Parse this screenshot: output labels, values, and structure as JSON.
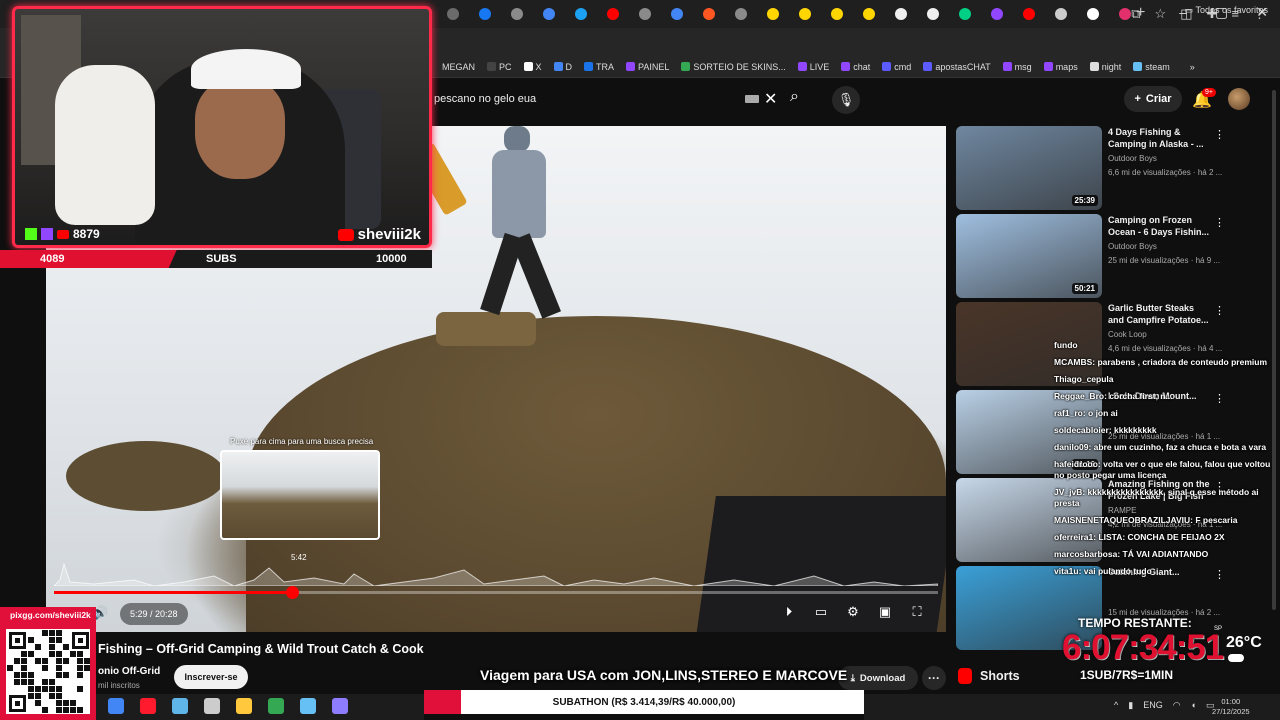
{
  "browser": {
    "tab_icons": [
      {
        "name": "tab-icon-a",
        "color": "#6b6b6b"
      },
      {
        "name": "tab-icon-facebook",
        "color": "#1877f2"
      },
      {
        "name": "tab-icon-b",
        "color": "#8a8a8a"
      },
      {
        "name": "tab-icon-google",
        "color": "#4285f4"
      },
      {
        "name": "tab-icon-c",
        "color": "#1da1f2"
      },
      {
        "name": "tab-icon-youtube",
        "color": "#ff0000"
      },
      {
        "name": "tab-icon-d",
        "color": "#8a8a8a"
      },
      {
        "name": "tab-icon-e",
        "color": "#4285f4"
      },
      {
        "name": "tab-icon-f",
        "color": "#ff5722"
      },
      {
        "name": "tab-icon-g",
        "color": "#8a8a8a"
      },
      {
        "name": "tab-icon-h",
        "color": "#ffd600"
      },
      {
        "name": "tab-icon-i",
        "color": "#ffd600"
      },
      {
        "name": "tab-icon-j",
        "color": "#ffd600"
      },
      {
        "name": "tab-icon-k",
        "color": "#ffd600"
      },
      {
        "name": "tab-icon-amazon",
        "color": "#f0f0f0"
      },
      {
        "name": "tab-icon-amazon-2",
        "color": "#f0f0f0"
      },
      {
        "name": "tab-icon-l",
        "color": "#00d084"
      },
      {
        "name": "tab-icon-twitch",
        "color": "#9146ff"
      },
      {
        "name": "tab-icon-m",
        "color": "#ff0000"
      },
      {
        "name": "tab-icon-download",
        "color": "#cccccc"
      },
      {
        "name": "tab-icon-tiktok",
        "color": "#ffffff"
      },
      {
        "name": "tab-icon-instagram",
        "color": "#e1306c"
      }
    ],
    "tab_new": "+",
    "bookmarks": [
      {
        "label": "MEGAN",
        "color": "#00000000"
      },
      {
        "label": "PC",
        "color": "#444444"
      },
      {
        "label": "X",
        "color": "#ffffff"
      },
      {
        "label": "D",
        "color": "#4285f4"
      },
      {
        "label": "TRA",
        "color": "#1a73e8"
      },
      {
        "label": "PAINEL",
        "color": "#9146ff"
      },
      {
        "label": "SORTEIO DE SKINS...",
        "color": "#34a853"
      },
      {
        "label": "LIVE",
        "color": "#9146ff"
      },
      {
        "label": "chat",
        "color": "#9146ff"
      },
      {
        "label": "cmd",
        "color": "#5b5bff"
      },
      {
        "label": "apostasCHAT",
        "color": "#5b5bff"
      },
      {
        "label": "msg",
        "color": "#9146ff"
      },
      {
        "label": "maps",
        "color": "#9146ff"
      },
      {
        "label": "night",
        "color": "#dddddd"
      },
      {
        "label": "steam",
        "color": "#66c0f4"
      }
    ],
    "bookmarks_more": "»",
    "all_bookmarks": "Todos os favoritos"
  },
  "youtube": {
    "search_value": "pescano no gelo eua",
    "create_label": "Criar",
    "notif_badge": "9+",
    "video": {
      "preview_hint": "Puxe para cima para uma busca precisa",
      "preview_time": "5:42",
      "time_display": "5:29 / 20:28",
      "progress_fraction": 0.269
    },
    "title": "Fishing – Off-Grid Camping & Wild Trout Catch & Cook",
    "channel": "onio Off-Grid",
    "channel_subs": "mil inscritos",
    "subscribe_label": "Inscrever-se",
    "download_label": "Download",
    "shorts_label": "Shorts",
    "recommendations": [
      {
        "title": "4 Days Fishing & Camping in Alaska - ...",
        "channel": "Outdoor Boys",
        "meta": "6,6 mi de visualizações · há 2 ...",
        "duration": "25:39",
        "thumb": "#6f87a0"
      },
      {
        "title": "Camping on Frozen Ocean - 6 Days Fishin...",
        "channel": "Outdoor Boys",
        "meta": "25 mi de visualizações · há 9 ...",
        "duration": "50:21",
        "thumb": "#9fbfe0"
      },
      {
        "title": "Garlic Butter Steaks and Campfire Potatoe...",
        "channel": "Cook Loop",
        "meta": "4,6 mi de visualizações · há 4 ...",
        "duration": "",
        "thumb": "#4a3528"
      },
      {
        "title": "I Solo Down Mount...",
        "channel": "",
        "meta": "25 mi de visualizações · há 1 ...",
        "duration": "31:16",
        "thumb": "#b9d0e6"
      },
      {
        "title": "Amazing Fishing on the Frozen Lake | Big Fish",
        "channel": "RAMPE",
        "meta": "4,2 mi de visualizações · há 1 ...",
        "duration": "",
        "thumb": "#c7d8ea"
      },
      {
        "title": "Catching Giant...",
        "channel": "",
        "meta": "15 mi de visualizações · há 2 ...",
        "duration": "",
        "thumb": "#3aa0d8"
      }
    ]
  },
  "chat": [
    {
      "user": "fundo",
      "text": ""
    },
    {
      "user": "MCAMBS",
      "text": ": parabens , criadora de conteudo premium"
    },
    {
      "user": "Thiago_cepula",
      "text": ""
    },
    {
      "user": "Reggae_Bro",
      "text": ": corcha first, n..."
    },
    {
      "user": "raf1_ro",
      "text": ": o jon ai"
    },
    {
      "user": "soldecabloier",
      "text": ": kkkkkkkkk"
    },
    {
      "user": "danilo09",
      "text": ": abre um cuzinho, faz a chuca e bota a vara"
    },
    {
      "user": "hafeidrooo",
      "text": ": volta ver o que ele falou, falou que voltou no posto pegar uma licença"
    },
    {
      "user": "JV_jvB",
      "text": ": kkkkkkkkkkkkkkkk, sinal q esse método ai presta"
    },
    {
      "user": "MAISNENETAQUEOBRAZILJAVIU",
      "text": ": F pescaria"
    },
    {
      "user": "oferreira1",
      "text": ": LISTA: CONCHA DE FEIJAO 2X"
    },
    {
      "user": "marcosbarbosa",
      "text": ": TÁ VAI ADIANTANDO"
    },
    {
      "user": "vita1u",
      "text": ": vai pulando tudo"
    }
  ],
  "overlay": {
    "kick_twitch_count": "8879",
    "youtube_handle": "sheviii2k",
    "subs_start": "4089",
    "subs_label": "SUBS",
    "subs_goal": "10000",
    "subs_fraction": 0.409,
    "qr_label": "pixgg.com/sheviii2k",
    "trip_banner": "Viagem para USA com JON,LINS,STEREO E MARCOVE",
    "subathon_text": "SUBATHON (R$ 3.414,39/R$ 40.000,00)",
    "subathon_fraction": 0.085,
    "timer_label": "TEMPO RESTANTE:",
    "timer": "6:07:34:51",
    "rate": "1SUB/7R$=1MIN",
    "weather_location": "SP",
    "weather_temp": "26°C"
  },
  "taskbar": {
    "icons": [
      {
        "name": "chrome",
        "color": "#4285f4"
      },
      {
        "name": "opera",
        "color": "#ff1b2d"
      },
      {
        "name": "files",
        "color": "#5fb4e8"
      },
      {
        "name": "settings",
        "color": "#cccccc"
      },
      {
        "name": "explorer",
        "color": "#ffc83d"
      },
      {
        "name": "chrome-2",
        "color": "#34a853"
      },
      {
        "name": "steam",
        "color": "#66c0f4"
      },
      {
        "name": "discord",
        "color": "#8e7cff"
      }
    ],
    "lang": "ENG",
    "time": "01:00",
    "date": "27/12/2025"
  }
}
